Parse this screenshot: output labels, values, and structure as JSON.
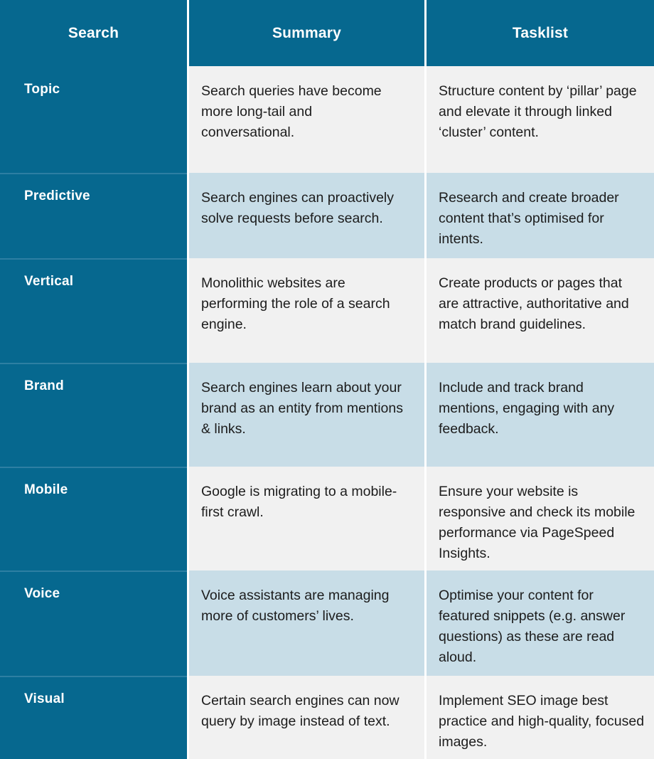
{
  "theme": {
    "header_bg": "#06688f",
    "label_bg": "#06688f",
    "row_gray": "#f1f1f1",
    "row_blue": "#c8dde7",
    "text_color": "#1c1c1c",
    "header_text": "#ffffff"
  },
  "table": {
    "columns": [
      {
        "key": "search",
        "label": "Search"
      },
      {
        "key": "summary",
        "label": "Summary"
      },
      {
        "key": "tasklist",
        "label": "Tasklist"
      }
    ],
    "rows": [
      {
        "search": "Topic",
        "summary": "Search queries have become more long-tail and conversational.",
        "tasklist": "Structure content by ‘pillar’ page and elevate it through linked ‘cluster’ content.",
        "shade": "gray"
      },
      {
        "search": "Predictive",
        "summary": "Search engines can proactively solve requests before search.",
        "tasklist": "Research and create broader content that’s optimised for intents.",
        "shade": "blue"
      },
      {
        "search": "Vertical",
        "summary": "Monolithic websites are performing the role of a search engine.",
        "tasklist": "Create products or pages that are attractive, authoritative and match brand guidelines.",
        "shade": "gray"
      },
      {
        "search": "Brand",
        "summary": "Search engines learn about your brand as an entity from mentions & links.",
        "tasklist": "Include and track brand mentions, engaging with any feedback.",
        "shade": "blue"
      },
      {
        "search": "Mobile",
        "summary": "Google is migrating to a mobile-first crawl.",
        "tasklist": "Ensure your website is responsive and check its mobile performance via PageSpeed Insights.",
        "shade": "gray"
      },
      {
        "search": "Voice",
        "summary": "Voice assistants are managing more of customers’ lives.",
        "tasklist": "Optimise your content for featured snippets (e.g. answer questions) as these are read aloud.",
        "shade": "blue"
      },
      {
        "search": "Visual",
        "summary": "Certain search engines can now query by image instead of text.",
        "tasklist": "Implement SEO image best practice and high-quality, focused images.",
        "shade": "gray"
      }
    ]
  }
}
